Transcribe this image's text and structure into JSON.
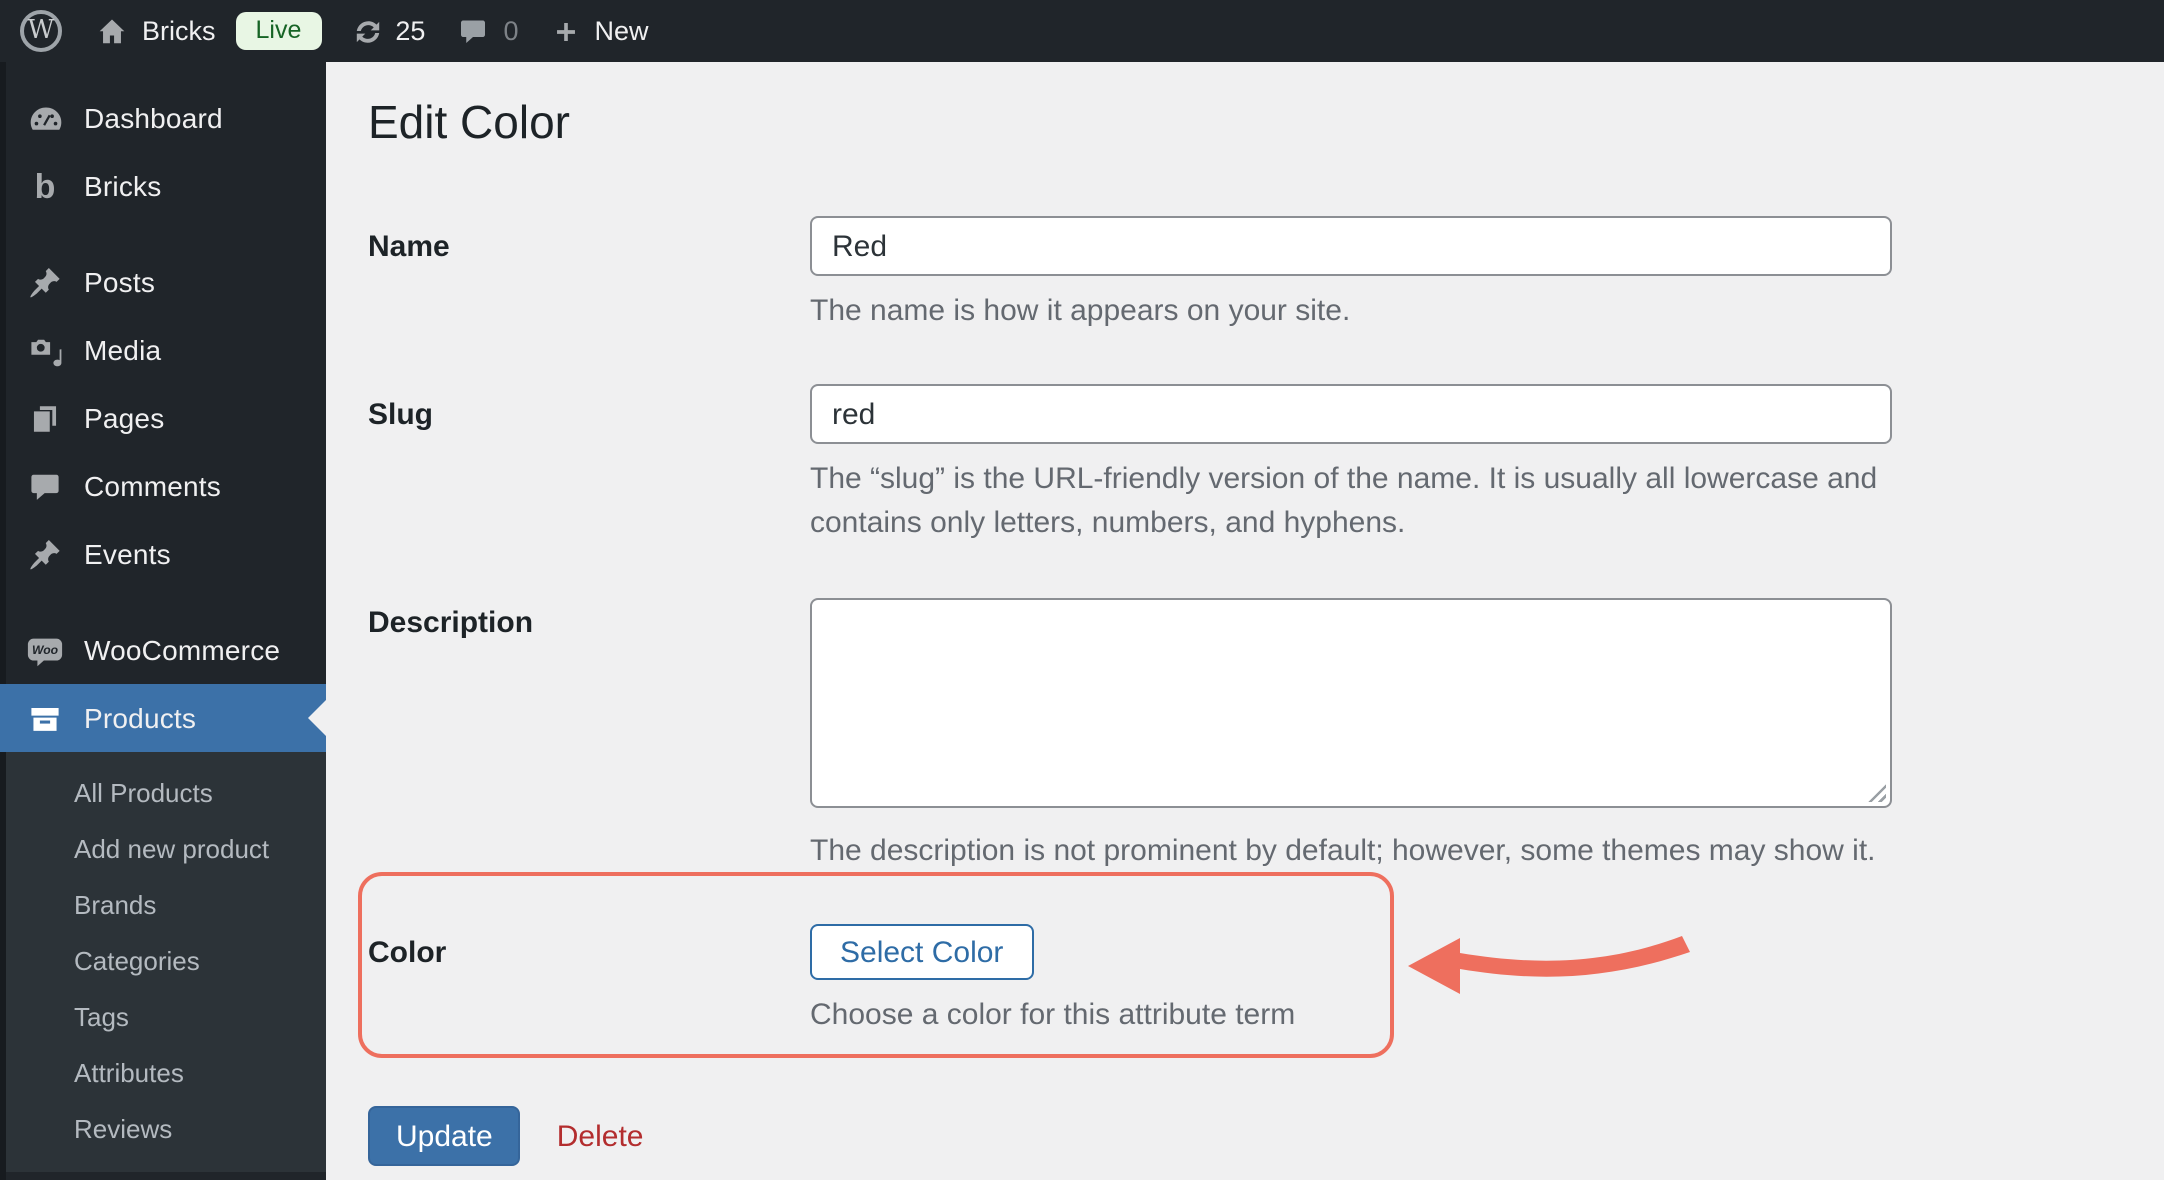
{
  "admin_bar": {
    "wp_logo": "W",
    "site_name": "Bricks",
    "live_badge": "Live",
    "update_count": "25",
    "comment_count": "0",
    "new_label": "New"
  },
  "sidebar": {
    "items": [
      {
        "label": "Dashboard"
      },
      {
        "label": "Bricks"
      },
      {
        "label": "Posts"
      },
      {
        "label": "Media"
      },
      {
        "label": "Pages"
      },
      {
        "label": "Comments"
      },
      {
        "label": "Events"
      },
      {
        "label": "WooCommerce"
      },
      {
        "label": "Products",
        "active": true
      }
    ],
    "submenu": [
      "All Products",
      "Add new product",
      "Brands",
      "Categories",
      "Tags",
      "Attributes",
      "Reviews"
    ],
    "woo_icon_text": "Woo",
    "bricks_icon_text": "b"
  },
  "main": {
    "title": "Edit Color",
    "fields": {
      "name": {
        "label": "Name",
        "value": "Red",
        "help": "The name is how it appears on your site."
      },
      "slug": {
        "label": "Slug",
        "value": "red",
        "help": "The “slug” is the URL-friendly version of the name. It is usually all lowercase and contains only letters, numbers, and hyphens."
      },
      "description": {
        "label": "Description",
        "value": "",
        "help": "The description is not prominent by default; however, some themes may show it."
      },
      "color": {
        "label": "Color",
        "button": "Select Color",
        "help": "Choose a color for this attribute term"
      }
    },
    "actions": {
      "update": "Update",
      "delete": "Delete"
    }
  },
  "colors": {
    "accent_blue": "#3c71a8",
    "link_blue": "#2e6ca6",
    "annotation_coral": "#ee6f5e",
    "delete_red": "#b32d2e",
    "live_badge_bg": "#e8f6e4",
    "live_badge_text": "#166425",
    "sidebar_bg": "#20252a",
    "submenu_bg": "#2c3338",
    "content_bg": "#f0f0f1"
  }
}
